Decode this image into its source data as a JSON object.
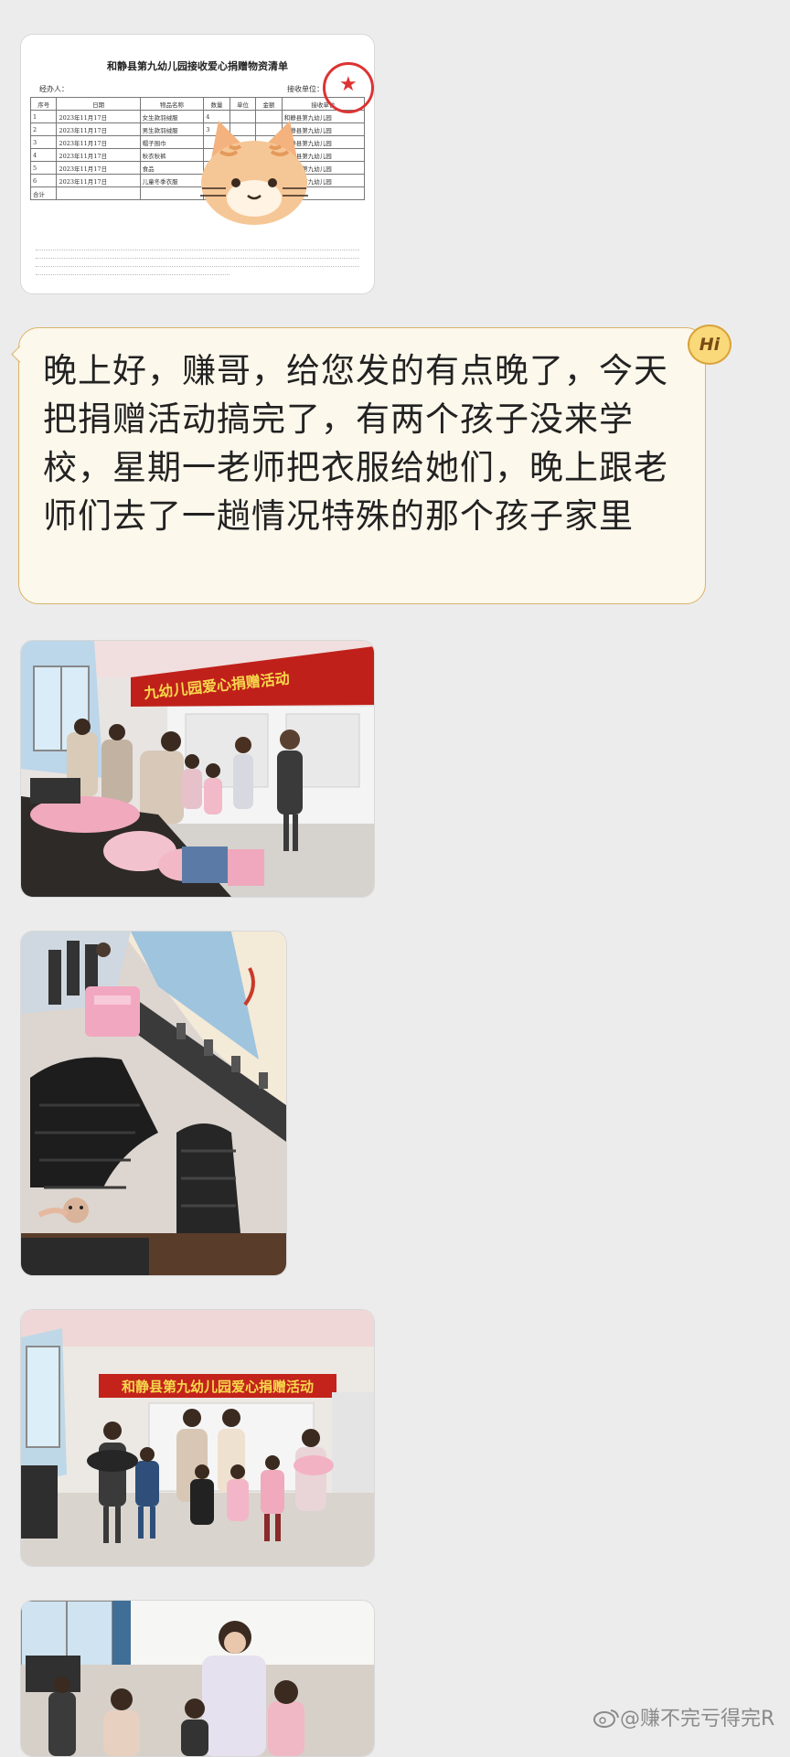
{
  "document_image": {
    "title": "和静县第九幼儿园接收爱心捐赠物资清单",
    "recorder": "经办人：",
    "receiver": "接收单位：",
    "columns": [
      "序号",
      "日期",
      "物品名称",
      "数量",
      "单位",
      "金额",
      "接收单位"
    ],
    "rows": [
      [
        "1",
        "2023年11月17日",
        "女生款羽绒服",
        "4",
        "",
        "",
        "和静县第九幼儿园"
      ],
      [
        "2",
        "2023年11月17日",
        "男生款羽绒服",
        "3",
        "",
        "",
        "和静县第九幼儿园"
      ],
      [
        "3",
        "2023年11月17日",
        "帽子围巾",
        "",
        "",
        "",
        "和静县第九幼儿园"
      ],
      [
        "4",
        "2023年11月17日",
        "秋衣秋裤",
        "",
        "",
        "",
        "和静县第九幼儿园"
      ],
      [
        "5",
        "2023年11月17日",
        "食品",
        "",
        "",
        "",
        "和静县第九幼儿园"
      ],
      [
        "6",
        "2023年11月17日",
        "儿童冬季衣服",
        "",
        "",
        "",
        "和静县第九幼儿园"
      ]
    ],
    "total_label": "合计"
  },
  "message": {
    "text": "晚上好，赚哥，给您发的有点晚了，今天把捐赠活动搞完了，有两个孩子没来学校，星期一老师把衣服给她们，晚上跟老师们去了一趟情况特殊的那个孩子家里",
    "badge": "Hi"
  },
  "watermark": {
    "text": "@赚不完亏得完R"
  },
  "colors": {
    "background": "#ececec",
    "bubble_fill": "#fdf8ec",
    "bubble_border": "#d9b36a",
    "banner_red": "#d8231a"
  },
  "icons": [
    "hi-badge-icon",
    "weibo-logo-icon",
    "cat-sticker-icon",
    "red-seal-icon"
  ]
}
